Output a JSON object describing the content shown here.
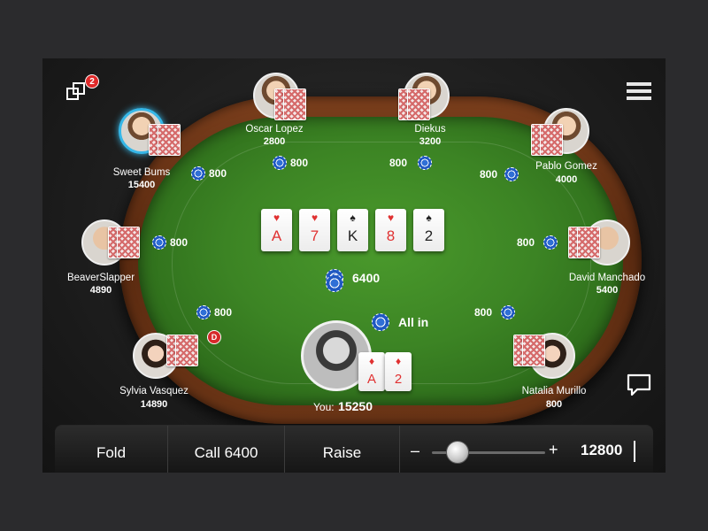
{
  "notifications": {
    "count": "2"
  },
  "board": {
    "cards": [
      {
        "rank": "A",
        "suit": "♥",
        "color": "red"
      },
      {
        "rank": "7",
        "suit": "♥",
        "color": "red"
      },
      {
        "rank": "K",
        "suit": "♠",
        "color": "black"
      },
      {
        "rank": "8",
        "suit": "♥",
        "color": "red"
      },
      {
        "rank": "2",
        "suit": "♠",
        "color": "black"
      }
    ],
    "pot": "6400"
  },
  "players": {
    "oscar": {
      "name": "Oscar Lopez",
      "chips": "2800"
    },
    "diekus": {
      "name": "Diekus",
      "chips": "3200"
    },
    "sweet": {
      "name": "Sweet Bums",
      "chips": "15400",
      "bet": "800"
    },
    "pablo": {
      "name": "Pablo Gomez",
      "chips": "4000",
      "bet": "800"
    },
    "beaver": {
      "name": "BeaverSlapper",
      "chips": "4890",
      "bet": "800"
    },
    "david": {
      "name": "David Manchado",
      "chips": "5400",
      "bet": "800"
    },
    "sylvia": {
      "name": "Sylvia Vasquez",
      "chips": "14890",
      "bet": "800"
    },
    "natalia": {
      "name": "Natalia Murillo",
      "chips": "800",
      "bet": "800"
    },
    "oscar_bet": "800",
    "diekus_bet": "800"
  },
  "you": {
    "label": "You:",
    "chips": "15250",
    "action": "All in",
    "cards": [
      {
        "rank": "A",
        "suit": "♦",
        "color": "red"
      },
      {
        "rank": "2",
        "suit": "♦",
        "color": "red"
      }
    ]
  },
  "dealer_label": "D",
  "actions": {
    "fold": "Fold",
    "call": "Call 6400",
    "raise": "Raise",
    "minus": "–",
    "plus": "+",
    "raise_amount": "12800"
  }
}
